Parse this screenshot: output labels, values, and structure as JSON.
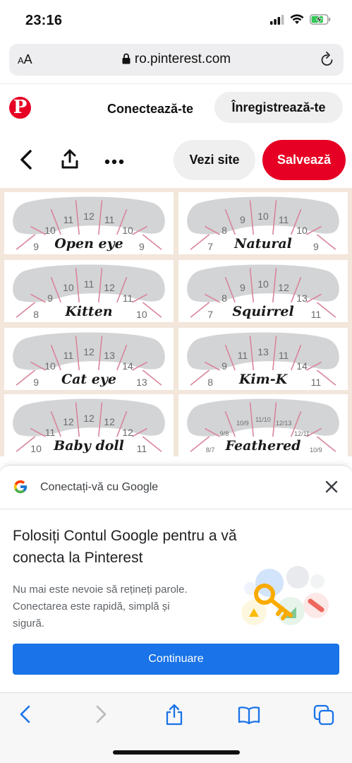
{
  "status_bar": {
    "time": "23:16",
    "battery_icon": "battery-charging-icon",
    "battery_level": 0.75
  },
  "address_bar": {
    "aa_label_big": "A",
    "aa_label_small": "A",
    "url": "ro.pinterest.com"
  },
  "pinterest_header": {
    "logo": "pinterest-logo",
    "login_label": "Conectează-te",
    "signup_label": "Înregistrează-te"
  },
  "pin_actions": {
    "visit_label": "Vezi site",
    "save_label": "Salvează",
    "accent": "#e60023"
  },
  "lash_map": {
    "styles": [
      {
        "name": "Open eye",
        "numbers": [
          "9",
          "10",
          "11",
          "12",
          "11",
          "10",
          "9"
        ]
      },
      {
        "name": "Natural",
        "numbers": [
          "7",
          "8",
          "9",
          "10",
          "11",
          "10",
          "9"
        ]
      },
      {
        "name": "Kitten",
        "numbers": [
          "8",
          "9",
          "10",
          "11",
          "12",
          "11",
          "10"
        ]
      },
      {
        "name": "Squirrel",
        "numbers": [
          "7",
          "8",
          "9",
          "10",
          "12",
          "13",
          "11"
        ]
      },
      {
        "name": "Cat eye",
        "numbers": [
          "9",
          "10",
          "11",
          "12",
          "13",
          "14",
          "13"
        ]
      },
      {
        "name": "Kim-K",
        "numbers": [
          "8",
          "9",
          "11",
          "13",
          "11",
          "14",
          "11"
        ]
      },
      {
        "name": "Baby doll",
        "numbers": [
          "10",
          "11",
          "12",
          "12",
          "12",
          "12",
          "11"
        ]
      },
      {
        "name": "Feathered",
        "numbers": [
          "8/7",
          "9/8",
          "10/9",
          "11/10",
          "12/13",
          "12/11",
          "10/9"
        ]
      }
    ]
  },
  "google_sheet": {
    "title": "Conectați-vă cu Google",
    "heading": "Folosiți Contul Google pentru a vă conecta la Pinterest",
    "body": "Nu mai este nevoie să rețineți parole. Conectarea este rapidă, simplă și sigură.",
    "continue_label": "Continuare",
    "accent": "#1a73e8"
  },
  "toolbar": {
    "icons": [
      "back-icon",
      "forward-icon",
      "share-icon",
      "bookmarks-icon",
      "tabs-icon"
    ]
  }
}
